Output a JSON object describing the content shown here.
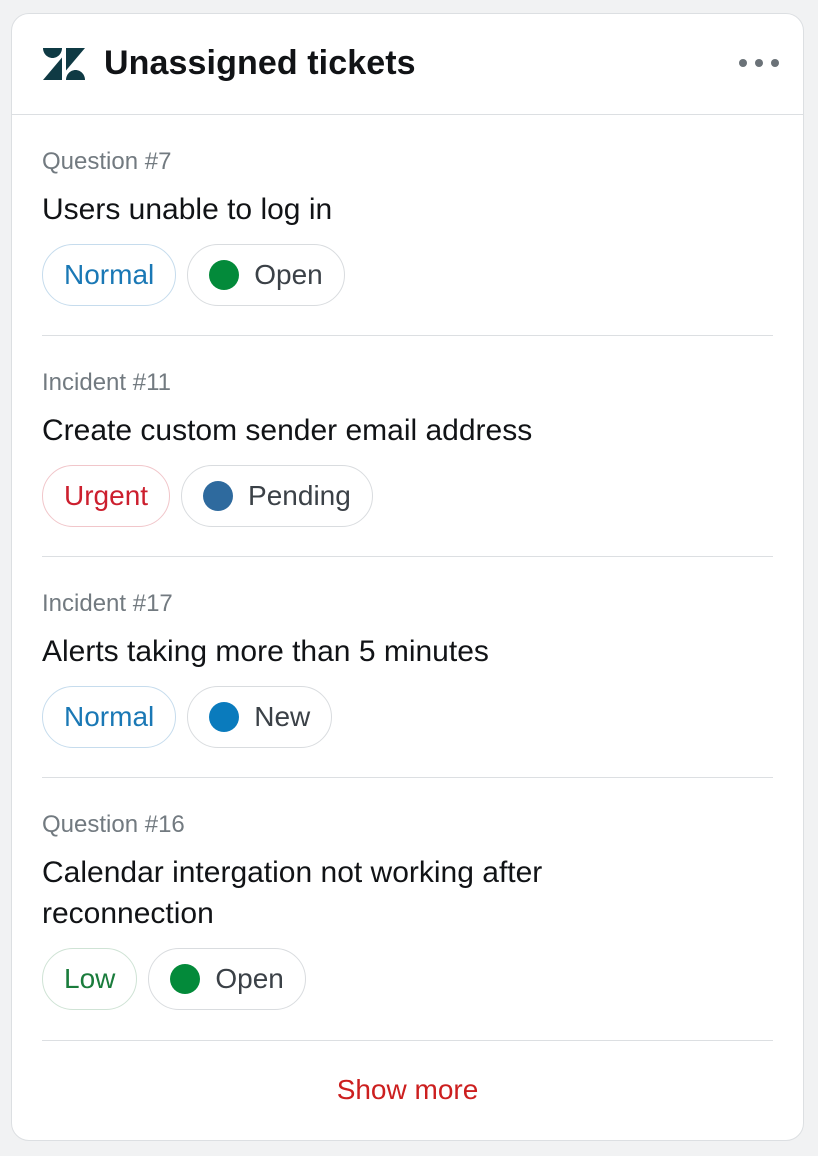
{
  "header": {
    "title": "Unassigned tickets",
    "logo_icon": "zendesk-logo",
    "menu_icon": "ellipsis-horizontal-icon"
  },
  "tickets": [
    {
      "type": "Question #7",
      "title": "Users unable to log in",
      "priority": "Normal",
      "status": "Open",
      "status_color": "#038a3a"
    },
    {
      "type": "Incident #11",
      "title": "Create custom sender email address",
      "priority": "Urgent",
      "status": "Pending",
      "status_color": "#2e6a9e"
    },
    {
      "type": "Incident #17",
      "title": "Alerts taking more than 5 minutes",
      "priority": "Normal",
      "status": "New",
      "status_color": "#0a7bbd"
    },
    {
      "type": "Question #16",
      "title": "Calendar intergation not working after reconnection",
      "priority": "Low",
      "status": "Open",
      "status_color": "#038a3a"
    }
  ],
  "footer": {
    "show_more_label": "Show more"
  },
  "colors": {
    "logo": "#0f3a44",
    "show_more": "#cc1f1f"
  }
}
